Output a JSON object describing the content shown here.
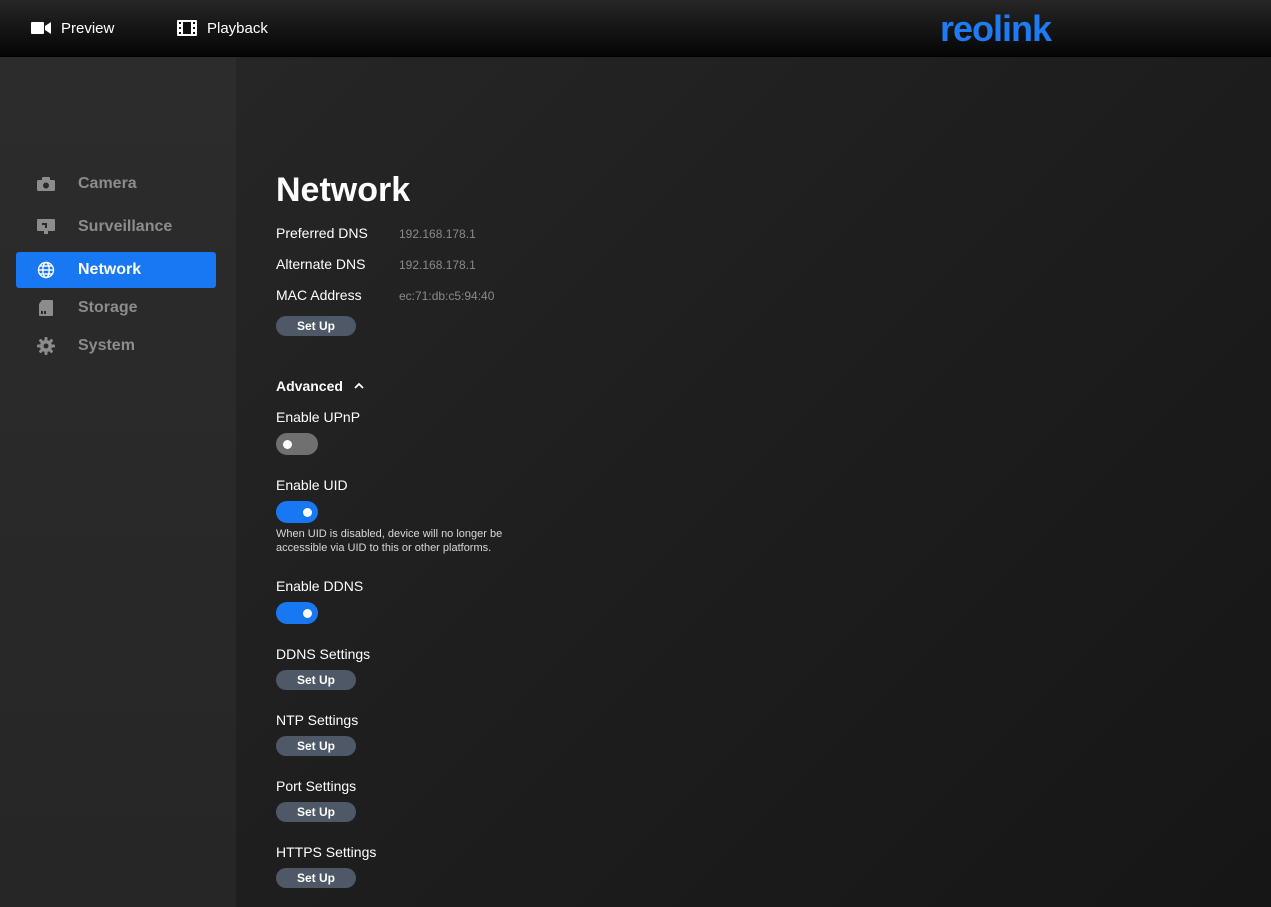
{
  "topbar": {
    "preview_label": "Preview",
    "playback_label": "Playback",
    "logo_text": "reolink"
  },
  "sidebar": {
    "items": [
      {
        "label": "Camera",
        "icon": "camera-icon"
      },
      {
        "label": "Surveillance",
        "icon": "monitor-icon"
      },
      {
        "label": "Network",
        "icon": "globe-icon",
        "active": true
      },
      {
        "label": "Storage",
        "icon": "sd-card-icon"
      },
      {
        "label": "System",
        "icon": "gear-icon"
      }
    ]
  },
  "network": {
    "title": "Network",
    "preferred_dns_label": "Preferred DNS",
    "preferred_dns_value": "192.168.178.1",
    "alternate_dns_label": "Alternate DNS",
    "alternate_dns_value": "192.168.178.1",
    "mac_label": "MAC Address",
    "mac_value": "ec:71:db:c5:94:40",
    "setup_label": "Set Up"
  },
  "advanced": {
    "header": "Advanced",
    "upnp_label": "Enable UPnP",
    "upnp_enabled": false,
    "uid_label": "Enable UID",
    "uid_enabled": true,
    "uid_hint": "When UID is disabled, device will no longer be accessible via UID to this or other platforms.",
    "ddns_label": "Enable DDNS",
    "ddns_enabled": true,
    "ddns_settings_label": "DDNS Settings",
    "ntp_settings_label": "NTP Settings",
    "port_settings_label": "Port Settings",
    "https_settings_label": "HTTPS Settings",
    "setup_label": "Set Up"
  },
  "colors": {
    "accent": "#1877f2",
    "button_bg": "#4e5866",
    "toggle_off": "#707070"
  }
}
